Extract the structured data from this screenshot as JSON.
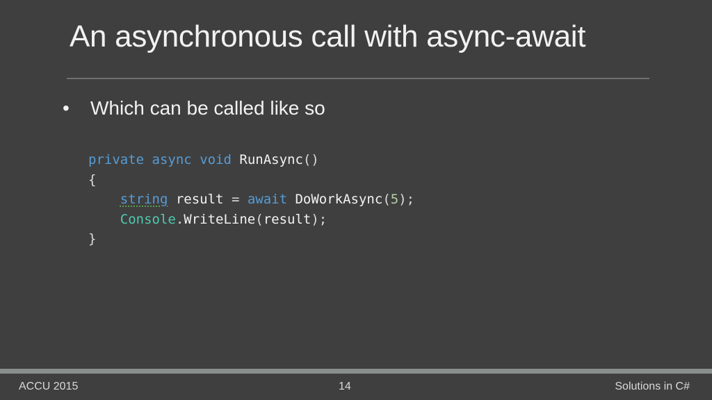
{
  "slide": {
    "title": "An asynchronous call with async-await",
    "bullet_symbol": "•",
    "bullet_text": "Which can be called like so"
  },
  "code": {
    "lines": [
      [
        {
          "text": "private",
          "kind": "keyword"
        },
        {
          "text": " ",
          "kind": "plain"
        },
        {
          "text": "async",
          "kind": "keyword"
        },
        {
          "text": " ",
          "kind": "plain"
        },
        {
          "text": "void",
          "kind": "keyword"
        },
        {
          "text": " ",
          "kind": "plain"
        },
        {
          "text": "RunAsync",
          "kind": "identifier"
        },
        {
          "text": "()",
          "kind": "plain"
        }
      ],
      [
        {
          "text": "{",
          "kind": "plain"
        }
      ],
      [
        {
          "text": "    ",
          "kind": "plain"
        },
        {
          "text": "string",
          "kind": "keyword-squiggle"
        },
        {
          "text": " ",
          "kind": "plain"
        },
        {
          "text": "result",
          "kind": "identifier"
        },
        {
          "text": " = ",
          "kind": "plain"
        },
        {
          "text": "await",
          "kind": "keyword"
        },
        {
          "text": " ",
          "kind": "plain"
        },
        {
          "text": "DoWorkAsync",
          "kind": "identifier"
        },
        {
          "text": "(",
          "kind": "plain"
        },
        {
          "text": "5",
          "kind": "number"
        },
        {
          "text": ");",
          "kind": "plain"
        }
      ],
      [
        {
          "text": "    ",
          "kind": "plain"
        },
        {
          "text": "Console",
          "kind": "type"
        },
        {
          "text": ".",
          "kind": "plain"
        },
        {
          "text": "WriteLine",
          "kind": "identifier"
        },
        {
          "text": "(",
          "kind": "plain"
        },
        {
          "text": "result",
          "kind": "identifier"
        },
        {
          "text": ");",
          "kind": "plain"
        }
      ],
      [
        {
          "text": "}",
          "kind": "plain"
        }
      ]
    ]
  },
  "footer": {
    "left": "ACCU 2015",
    "center": "14",
    "right": "Solutions in C#"
  },
  "colors": {
    "background": "#3f3f3f",
    "keyword": "#569cd6",
    "type": "#4ec9b0",
    "number": "#b5cea8",
    "squiggle": "#57a64a"
  }
}
